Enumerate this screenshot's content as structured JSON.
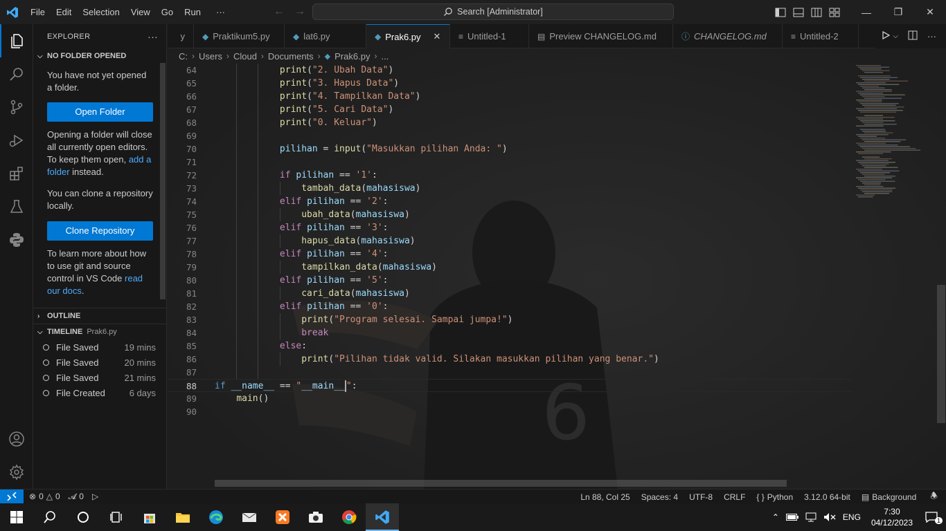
{
  "titlebar": {
    "menu": [
      "File",
      "Edit",
      "Selection",
      "View",
      "Go",
      "Run"
    ],
    "more": "···",
    "search": "Search [Administrator]",
    "window_controls": [
      "minimize-icon",
      "restore-icon",
      "close-icon"
    ]
  },
  "explorer": {
    "title": "EXPLORER",
    "more": "···",
    "section_no_folder": "NO FOLDER OPENED",
    "msg_not_opened": "You have not yet opened a folder.",
    "open_folder_btn": "Open Folder",
    "msg_opening_part1": "Opening a folder will close all currently open editors. To keep them open, ",
    "msg_opening_link": "add a folder",
    "msg_opening_part2": " instead.",
    "msg_clone": "You can clone a repository locally.",
    "clone_btn": "Clone Repository",
    "msg_git_part1": "To learn more about how to use git and source control in VS Code ",
    "msg_git_link": "read our docs",
    "msg_git_part2": ".",
    "outline": "OUTLINE",
    "timeline": "TIMELINE",
    "timeline_file": "Prak6.py",
    "timeline_items": [
      {
        "label": "File Saved",
        "time": "19 mins"
      },
      {
        "label": "File Saved",
        "time": "20 mins"
      },
      {
        "label": "File Saved",
        "time": "21 mins"
      },
      {
        "label": "File Created",
        "time": "6 days"
      }
    ]
  },
  "tabs": [
    {
      "name": "y",
      "active": false,
      "italic": false
    },
    {
      "name": "Praktikum5.py",
      "active": false,
      "italic": false
    },
    {
      "name": "lat6.py",
      "active": false,
      "italic": false
    },
    {
      "name": "Prak6.py",
      "active": true,
      "italic": false
    },
    {
      "name": "Untitled-1",
      "active": false,
      "italic": false
    },
    {
      "name": "Preview CHANGELOG.md",
      "active": false,
      "italic": false
    },
    {
      "name": "CHANGELOG.md",
      "active": false,
      "italic": true
    },
    {
      "name": "Untitled-2",
      "active": false,
      "italic": false
    }
  ],
  "breadcrumb": [
    "C:",
    "Users",
    "Cloud",
    "Documents",
    "Prak6.py",
    "..."
  ],
  "code": {
    "first_line": 64,
    "current_line": 88,
    "lines": [
      "            print(\"2. Ubah Data\")",
      "            print(\"3. Hapus Data\")",
      "            print(\"4. Tampilkan Data\")",
      "            print(\"5. Cari Data\")",
      "            print(\"0. Keluar\")",
      "",
      "            pilihan = input(\"Masukkan pilihan Anda: \")",
      "",
      "            if pilihan == '1':",
      "                tambah_data(mahasiswa)",
      "            elif pilihan == '2':",
      "                ubah_data(mahasiswa)",
      "            elif pilihan == '3':",
      "                hapus_data(mahasiswa)",
      "            elif pilihan == '4':",
      "                tampilkan_data(mahasiswa)",
      "            elif pilihan == '5':",
      "                cari_data(mahasiswa)",
      "            elif pilihan == '0':",
      "                print(\"Program selesai. Sampai jumpa!\")",
      "                break",
      "            else:",
      "                print(\"Pilihan tidak valid. Silakan masukkan pilihan yang benar.\")",
      "",
      "if __name__ == \"__main__\":",
      "    main()",
      ""
    ]
  },
  "statusbar": {
    "errors": "0",
    "warnings": "0",
    "ports": "0",
    "position": "Ln 88, Col 25",
    "spaces": "Spaces: 4",
    "encoding": "UTF-8",
    "eol": "CRLF",
    "language": "Python",
    "interpreter": "3.12.0 64-bit",
    "background": "Background"
  },
  "taskbar": {
    "apps": [
      "windows-start-icon",
      "search-icon",
      "cortana-icon",
      "task-view-icon",
      "store-icon",
      "file-explorer-icon",
      "edge-icon",
      "mail-icon",
      "xampp-icon",
      "camera-icon",
      "chrome-icon",
      "vscode-icon"
    ],
    "language": "ENG",
    "time": "7:30",
    "date": "04/12/2023",
    "notifications": "1"
  },
  "colors": {
    "accent": "#0078d4",
    "keyword": "#c586c0",
    "keyword_blue": "#569cd6",
    "function": "#dcdcaa",
    "string": "#ce9178",
    "variable": "#9cdcfe"
  }
}
